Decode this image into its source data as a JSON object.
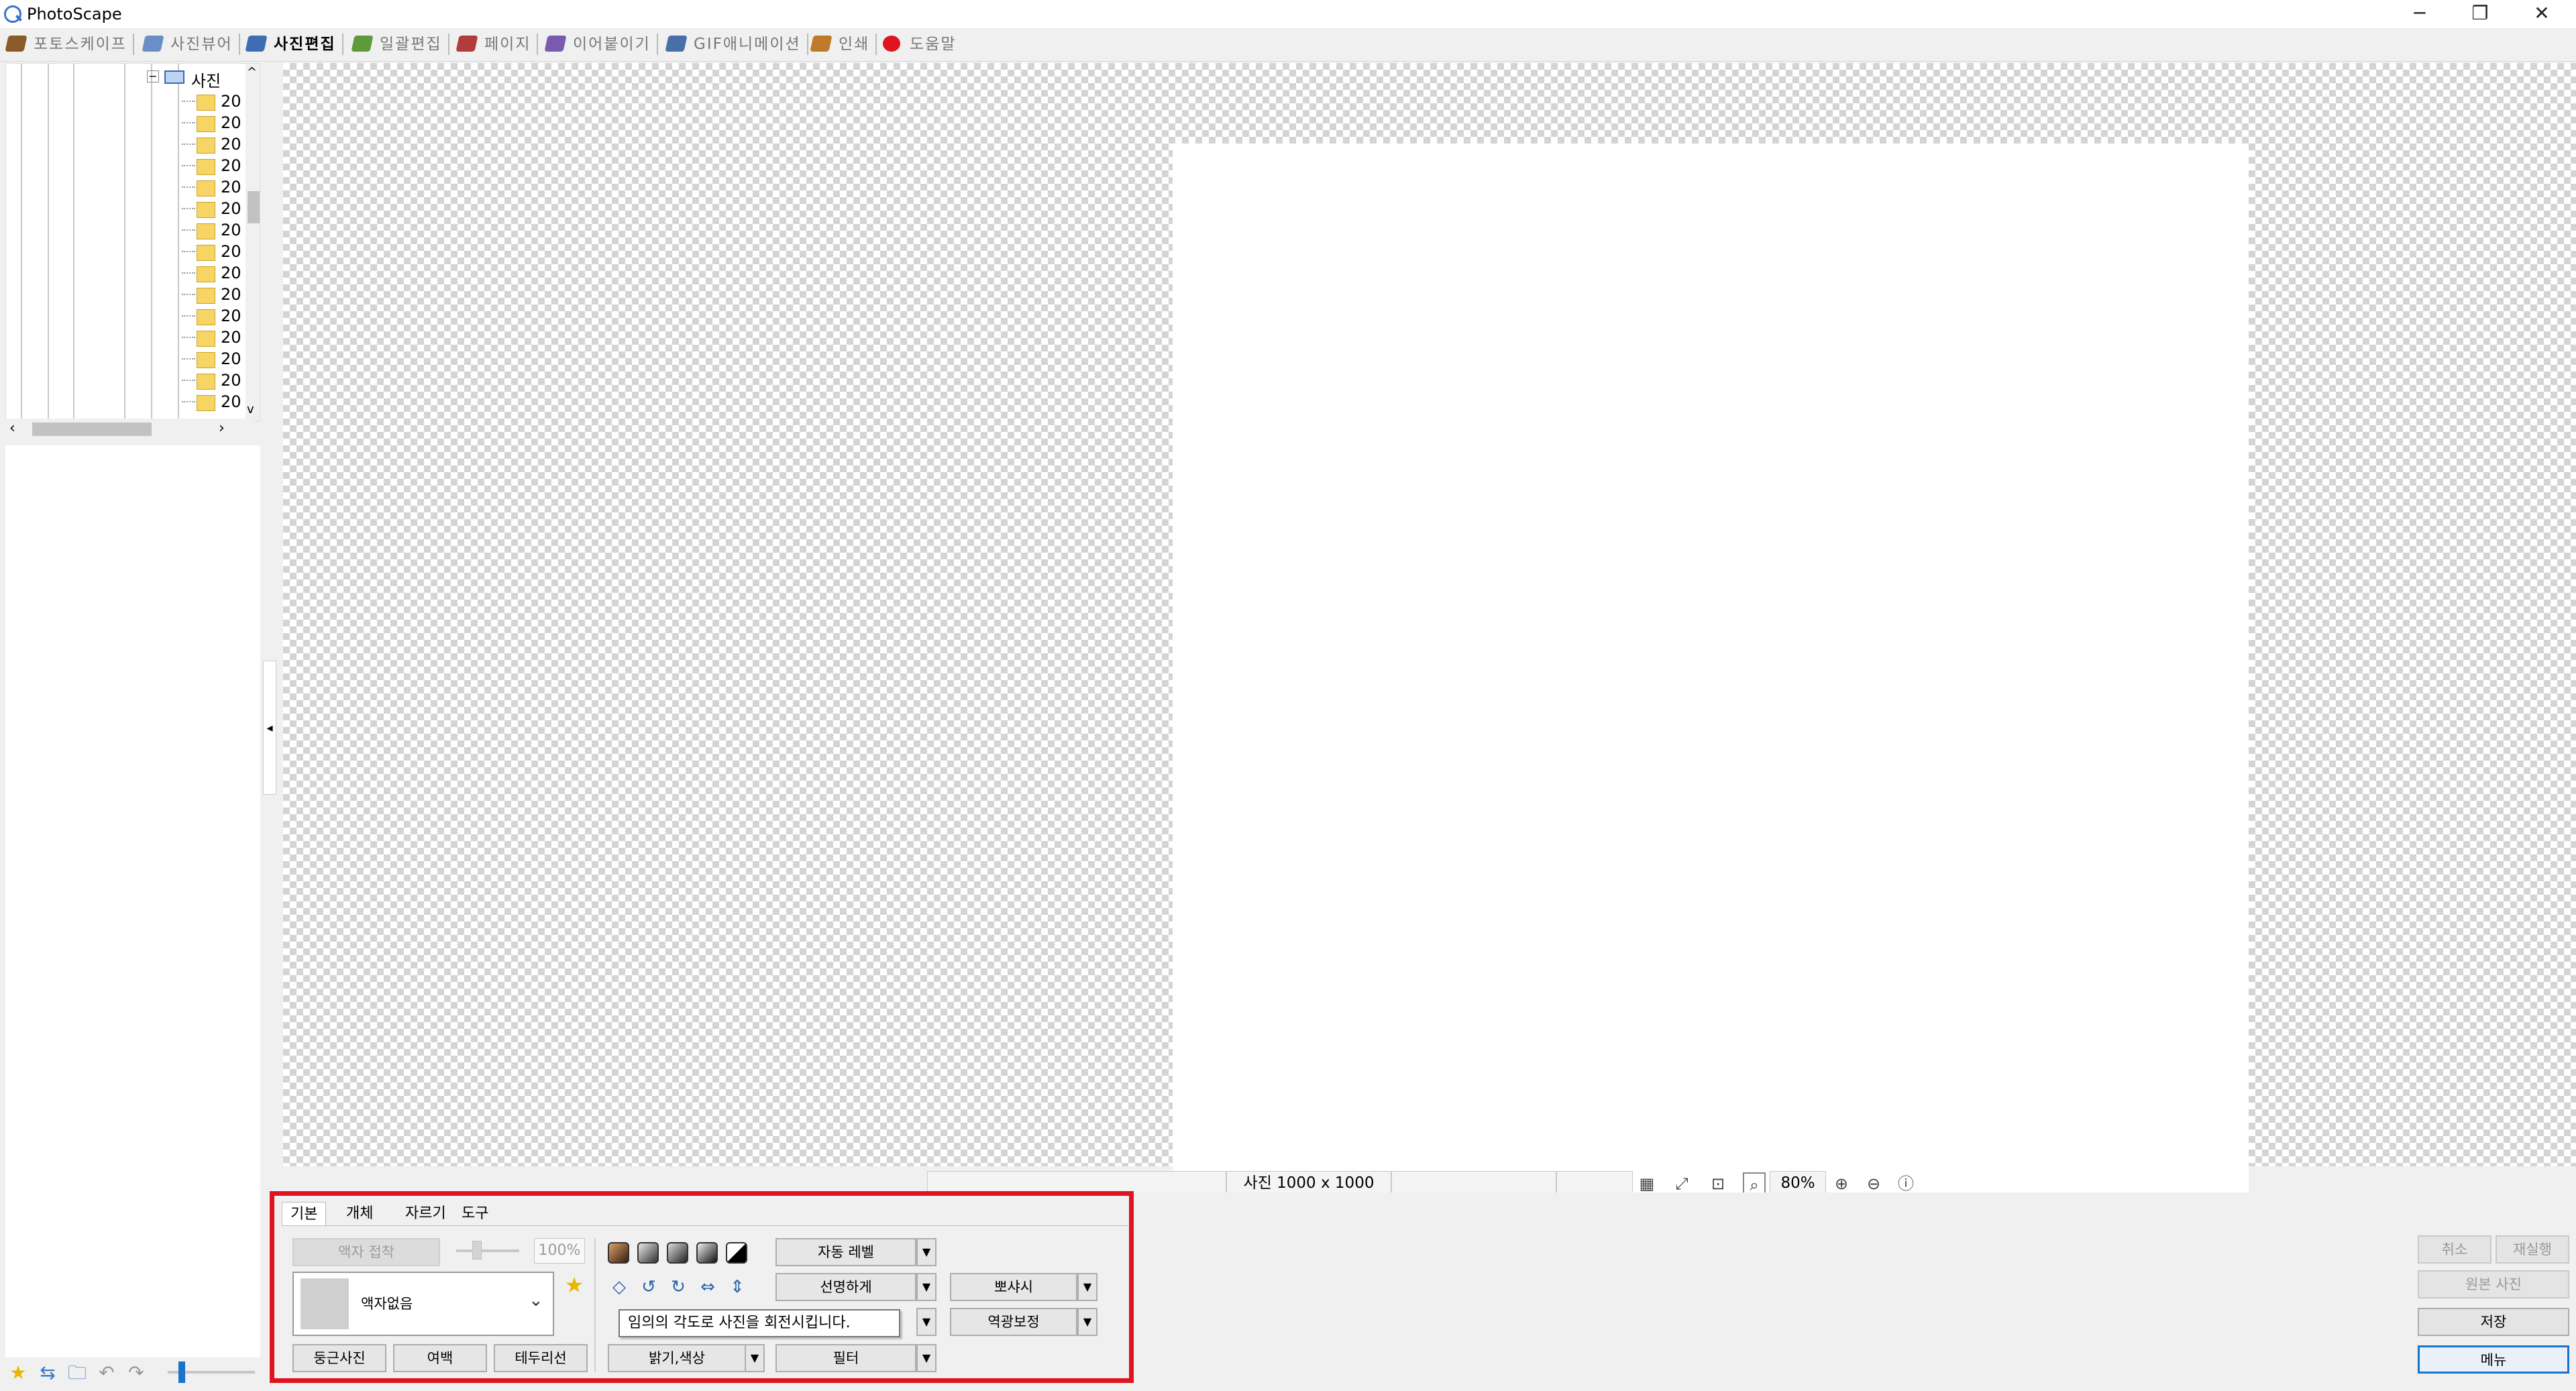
{
  "window": {
    "title": "PhotoScape",
    "minimize": "─",
    "restore": "❐",
    "close": "✕"
  },
  "tabs": [
    {
      "label": "포토스케이프",
      "color": "#8a5a2b",
      "active": false
    },
    {
      "label": "사진뷰어",
      "color": "#6a8fc7",
      "active": false
    },
    {
      "label": "사진편집",
      "color": "#3e6db2",
      "active": true
    },
    {
      "label": "일괄편집",
      "color": "#5d9a3c",
      "active": false
    },
    {
      "label": "페이지",
      "color": "#b23b3b",
      "active": false
    },
    {
      "label": "이어붙이기",
      "color": "#7b5bb0",
      "active": false
    },
    {
      "label": "GIF애니메이션",
      "color": "#4a6fa8",
      "active": false
    },
    {
      "label": "인쇄",
      "color": "#c07a2c",
      "active": false
    },
    {
      "label": "도움말",
      "color": "#e0141e",
      "active": false
    }
  ],
  "tree": {
    "root_label": "사진",
    "folders": [
      "20",
      "20",
      "20",
      "20",
      "20",
      "20",
      "20",
      "20",
      "20",
      "20",
      "20",
      "20",
      "20",
      "20",
      "20"
    ]
  },
  "status": {
    "photo_size": "사진 1000 x 1000",
    "zoom": "80%"
  },
  "bottom_panel": {
    "subtabs": [
      "기본",
      "개체",
      "자르기",
      "도구"
    ],
    "frame_merge": "액자 접착",
    "opacity_value": "100%",
    "frame_select": "액자없음",
    "round_photo": "둥근사진",
    "margin": "여백",
    "border_line": "테두리선",
    "auto_level": "자동 레벨",
    "sharpen": "선명하게",
    "bokeh": "뽀샤시",
    "backlight": "역광보정",
    "brightness_color": "밝기,색상",
    "filter": "필터",
    "tooltip": "임의의 각도로 사진을 회전시킵니다."
  },
  "right_buttons": {
    "undo": "취소",
    "redo": "재실행",
    "original": "원본 사진",
    "save": "저장",
    "menu": "메뉴"
  },
  "icons": {
    "star": "★",
    "arrows": "⇆",
    "folder_open": "🗀",
    "back": "↶",
    "forward": "↷",
    "zoom_in": "⊕",
    "zoom_out": "⊖",
    "fit": "⤢",
    "actual": "⊡",
    "info": "ⓘ",
    "rotate_left": "↺",
    "rotate_right": "↻",
    "flip_h": "⇔",
    "flip_v": "⇕",
    "rotate_any": "◇",
    "chevron_down": "⌄",
    "dropdown": "▼",
    "collapse": "◂"
  }
}
